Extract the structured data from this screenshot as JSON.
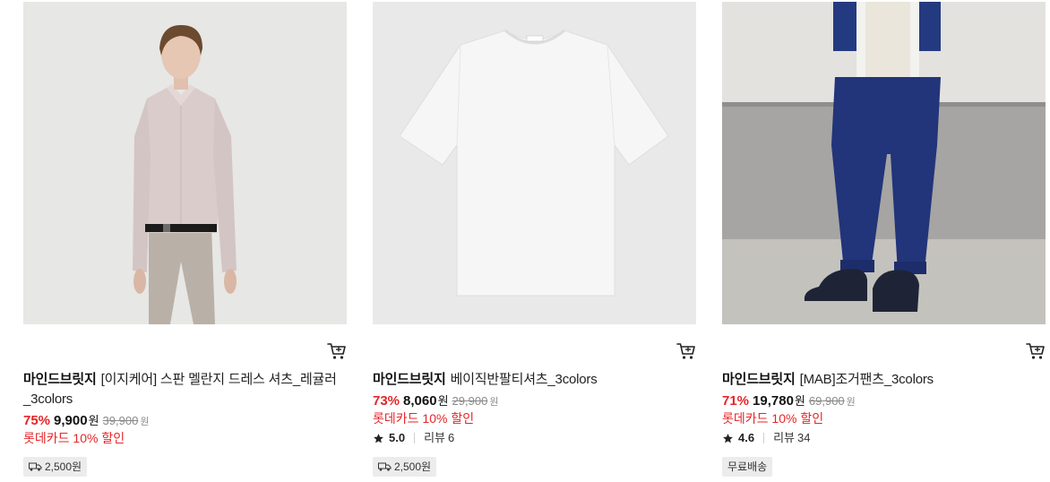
{
  "products": [
    {
      "brand": "마인드브릿지",
      "name": "[이지케어] 스판 멜란지 드레스 셔츠_레귤러_3colors",
      "discount_rate": "75%",
      "sale_price": "9,900",
      "sale_unit": "원",
      "original_price": "39,900",
      "original_unit": "원",
      "card_discount": "롯데카드 10% 할인",
      "rating": "",
      "review_label": "",
      "review_count": "",
      "shipping_badge": "2,500원",
      "shipping_icon": "truck-icon"
    },
    {
      "brand": "마인드브릿지",
      "name": "베이직반팔티셔츠_3colors",
      "discount_rate": "73%",
      "sale_price": "8,060",
      "sale_unit": "원",
      "original_price": "29,900",
      "original_unit": "원",
      "card_discount": "롯데카드 10% 할인",
      "rating": "5.0",
      "review_label": "리뷰",
      "review_count": "6",
      "shipping_badge": "2,500원",
      "shipping_icon": "truck-icon"
    },
    {
      "brand": "마인드브릿지",
      "name": "[MAB]조거팬츠_3colors",
      "discount_rate": "71%",
      "sale_price": "19,780",
      "sale_unit": "원",
      "original_price": "69,900",
      "original_unit": "원",
      "card_discount": "롯데카드 10% 할인",
      "rating": "4.6",
      "review_label": "리뷰",
      "review_count": "34",
      "shipping_badge": "무료배송",
      "shipping_icon": ""
    }
  ],
  "colors": {
    "discount_red": "#e52528",
    "badge_bg": "#ececec",
    "strike_gray": "#8a8a8a"
  }
}
